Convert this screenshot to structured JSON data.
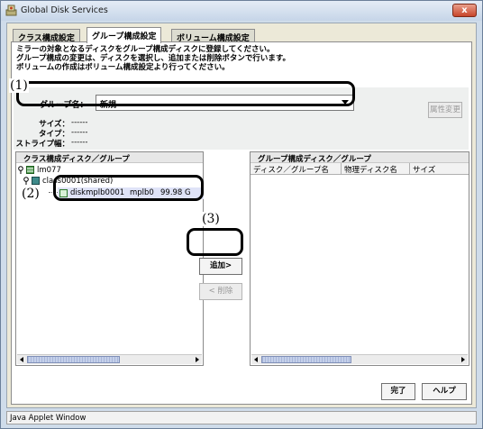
{
  "window": {
    "title": "Global Disk Services",
    "close_label": "x",
    "status_bar": "Java Applet Window"
  },
  "tabs": [
    {
      "label": "クラス構成設定"
    },
    {
      "label": "グループ構成設定"
    },
    {
      "label": "ボリューム構成設定"
    }
  ],
  "description": [
    "ミラーの対象となるディスクをグループ構成ディスクに登録してください。",
    "グループ構成の変更は、ディスクを選択し、追加または削除ボタンで行います。",
    "ボリュームの作成はボリューム構成設定より行ってください。"
  ],
  "group": {
    "name_label": "グループ名：",
    "name_value": "新規",
    "size_label": "サイズ：",
    "size_value": "------",
    "type_label": "タイプ：",
    "type_value": "------",
    "stripe_label": "ストライプ幅：",
    "stripe_value": "------",
    "attr_button": "属性変更"
  },
  "left_panel": {
    "header": "クラス構成ディスク／グループ",
    "tree": {
      "node": "lm077",
      "class_node": "class0001(shared)",
      "disk_name": "diskmplb0001",
      "disk_device": "mplb0",
      "disk_size": "99.98 G"
    }
  },
  "right_panel": {
    "header": "グループ構成ディスク／グループ",
    "columns": [
      "ディスク／グループ名",
      "物理ディスク名",
      "サイズ"
    ]
  },
  "buttons": {
    "add": "追加>",
    "remove": "< 削除",
    "done": "完了",
    "help": "ヘルプ"
  },
  "callouts": [
    "(1)",
    "(2)",
    "(3)"
  ]
}
